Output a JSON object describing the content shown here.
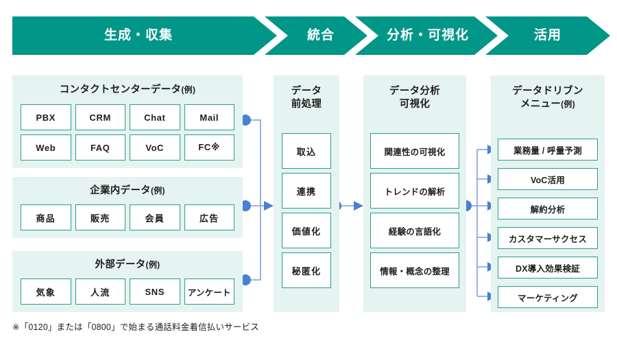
{
  "colors": {
    "banner": "#009688",
    "panel_bg": "#e5f3f1",
    "tag_border": "#2a9d8f",
    "connector_dot": "#4a7fd4",
    "connector_line": "#8fa9de",
    "text": "#1d1d1d"
  },
  "banner": {
    "stages": [
      {
        "label": "生成・収集"
      },
      {
        "label": "統合"
      },
      {
        "label": "分析・可視化"
      },
      {
        "label": "活用"
      }
    ]
  },
  "panels": {
    "contact_center": {
      "title_main": "コンタクトセンターデータ",
      "title_paren": "(例)",
      "tags": [
        "PBX",
        "CRM",
        "Chat",
        "Mail",
        "Web",
        "FAQ",
        "VoC",
        "FC※"
      ]
    },
    "internal": {
      "title_main": "企業内データ",
      "title_paren": "(例)",
      "tags": [
        "商品",
        "販売",
        "会員",
        "広告"
      ]
    },
    "external": {
      "title_main": "外部データ",
      "title_paren": "(例)",
      "tags": [
        "気象",
        "人流",
        "SNS",
        "アンケート"
      ]
    },
    "preprocess": {
      "title_line1": "データ",
      "title_line2": "前処理",
      "tags": [
        "取込",
        "連携",
        "価値化",
        "秘匿化"
      ]
    },
    "analysis": {
      "title_line1": "データ分析",
      "title_line2": "可視化",
      "tags": [
        "関連性の可視化",
        "トレンドの解析",
        "経験の言語化",
        "情報・概念の整理"
      ]
    },
    "menu": {
      "title_line1": "データドリブン",
      "title_line2_main": "メニュー",
      "title_line2_paren": "(例)",
      "tags": [
        "業務量 / 呼量予測",
        "VoC活用",
        "解約分析",
        "カスタマーサクセス",
        "DX導入効果検証",
        "マーケティング"
      ]
    }
  },
  "footnote": {
    "text": "※「0120」または「0800」で始まる通話料金着信払いサービス"
  }
}
